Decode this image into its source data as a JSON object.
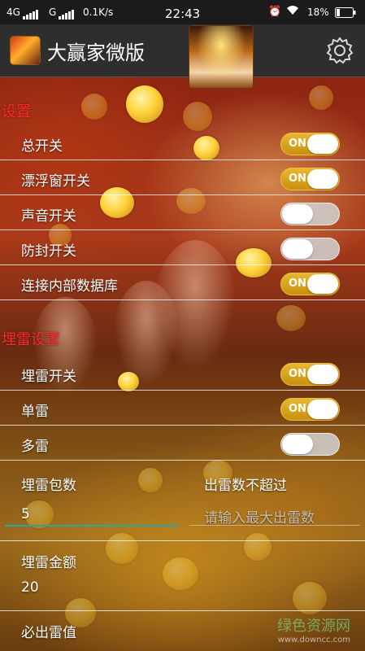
{
  "status_bar": {
    "network_1": "4G",
    "network_2": "G",
    "speed": "0.1K/s",
    "time": "22:43",
    "battery": "18%"
  },
  "header": {
    "title": "大赢家微版",
    "settings_icon": "gear-icon"
  },
  "settings": {
    "section_title": "设置",
    "items": [
      {
        "label": "总开关",
        "on": true
      },
      {
        "label": "漂浮窗开关",
        "on": true
      },
      {
        "label": "声音开关",
        "on": false
      },
      {
        "label": "防封开关",
        "on": false
      },
      {
        "label": "连接内部数据库",
        "on": true
      }
    ]
  },
  "mine": {
    "section_title": "埋雷设置",
    "items": [
      {
        "label": "埋雷开关",
        "on": true
      },
      {
        "label": "单雷",
        "on": true
      },
      {
        "label": "多雷",
        "on": false
      }
    ],
    "packets_label": "埋雷包数",
    "packets_value": "5",
    "max_mines_label": "出雷数不超过",
    "max_mines_placeholder": "请输入最大出雷数",
    "amount_label": "埋雷金额",
    "amount_value": "20",
    "must_mine_label": "必出雷值"
  },
  "toggle_on_text": "ON",
  "watermark": {
    "main": "绿色资源网",
    "sub": "www.downcc.com"
  },
  "colors": {
    "section_title": "#ff2a2a",
    "toggle_on": "#d8a420",
    "input_underline": "#2aa7a0"
  }
}
